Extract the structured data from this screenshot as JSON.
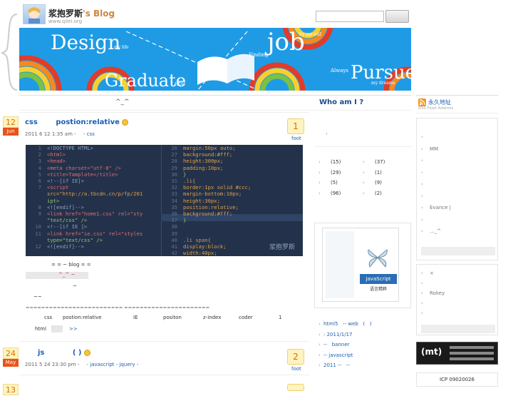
{
  "header": {
    "title": "浆抱罗斯",
    "title_suffix": "'s Blog",
    "url": "www.qilei.org",
    "search_placeholder": ""
  },
  "banner": {
    "word_design": "Design",
    "word_mylife": "my life",
    "word_finding": "Finding",
    "word_job": "job",
    "word_byself": "by my self",
    "word_graduate": "Graduate",
    "word_hdu": "HDU",
    "word_always": "Always",
    "word_pursue": "Pursue",
    "word_dreams": "my dreams"
  },
  "nav": {
    "face": "^_^"
  },
  "posts": [
    {
      "day": "12",
      "month": "Jun",
      "title_a": "css",
      "title_b": "postion:relative",
      "meta": "2011 6 12  1:35 am -",
      "meta_tag": "- css",
      "count": "1",
      "foot": "foot",
      "body": {
        "line1": "= =  ~ blog  = =",
        "line2": "^_^ ~",
        "line3": "~",
        "line4": "~~",
        "sep": "=========================    ======================",
        "keywords": [
          "css",
          "postion:relative",
          "IE",
          "positon",
          "z-index",
          "coder",
          "1"
        ],
        "html": "html",
        "more": ">>"
      }
    },
    {
      "day": "24",
      "month": "May",
      "title_a": "js",
      "title_b": "( )",
      "meta": "2011 5 24  23:30 pm -",
      "meta_tag": "- javascript - jquery -",
      "count": "2",
      "foot": "foot"
    },
    {
      "day": "13",
      "month": "",
      "title_a": "",
      "title_b": "",
      "meta": "",
      "meta_tag": "",
      "count": "",
      "foot": ""
    }
  ],
  "code": {
    "left": [
      {
        "n": "1",
        "t": "<!DOCTYPE HTML>"
      },
      {
        "n": "2",
        "t": "<html>"
      },
      {
        "n": "3",
        "t": "<head>"
      },
      {
        "n": "4",
        "t": "<meta charset=\"utf-8\" />"
      },
      {
        "n": "5",
        "t": "<title>Tamplate</title>"
      },
      {
        "n": "6",
        "t": "<!--[if IE]>"
      },
      {
        "n": "7",
        "t": "<script"
      },
      {
        "n": "",
        "t": "src=\"http://a.tbcdn.cn/p/fp/201"
      },
      {
        "n": "",
        "t": "ipt>"
      },
      {
        "n": "8",
        "t": "<![endif]-->"
      },
      {
        "n": "9",
        "t": "<link href=\"home1.css\" rel=\"sty"
      },
      {
        "n": "",
        "t": "\"text/css\" />"
      },
      {
        "n": "10",
        "t": "<!--[if IE ]>"
      },
      {
        "n": "11",
        "t": "<link href=\"ie.css\" rel=\"styles"
      },
      {
        "n": "",
        "t": "type=\"text/css\" />"
      },
      {
        "n": "12",
        "t": "<![endif]-->"
      }
    ],
    "right": [
      {
        "n": "26",
        "t": "margin:50px auto;"
      },
      {
        "n": "27",
        "t": "background:#fff;"
      },
      {
        "n": "28",
        "t": "height:300px;"
      },
      {
        "n": "29",
        "t": "padding:10px;"
      },
      {
        "n": "30",
        "t": "}"
      },
      {
        "n": "31",
        "t": ".li{"
      },
      {
        "n": "32",
        "t": "border:1px solid #ccc;"
      },
      {
        "n": "33",
        "t": "margin-bottom:10px;"
      },
      {
        "n": "34",
        "t": "height:30px;"
      },
      {
        "n": "35",
        "t": "position:relative;"
      },
      {
        "n": "36",
        "t": "background:#fff;"
      },
      {
        "n": "37",
        "t": "}"
      },
      {
        "n": "38",
        "t": ""
      },
      {
        "n": "39",
        "t": ""
      },
      {
        "n": "40",
        "t": ".li span{"
      },
      {
        "n": "41",
        "t": "display:block;"
      },
      {
        "n": "42",
        "t": "width:40px;"
      }
    ],
    "watermark": "浆抱罗斯"
  },
  "sidebar": {
    "whoami": "Who am I ?",
    "whoami_text": ".",
    "stats": [
      {
        "a": "(15)",
        "b": "(37)"
      },
      {
        "a": "(29)",
        "b": "(1)"
      },
      {
        "a": "(5)",
        "b": "(9)"
      },
      {
        "a": "(96)",
        "b": "(2)"
      }
    ],
    "book_title": "JavaScript",
    "book_sub": "语言精粹",
    "recent": [
      "html5   -- web   (   )",
      ": 2011/1/17",
      "--   banner",
      "-- javascript",
      "2011 --   --"
    ],
    "rss_title": "永久地址",
    "rss_sub": "RSS    Feed Address",
    "right_list": [
      "",
      "MM",
      "",
      "",
      "",
      "",
      "Evance |",
      "",
      "..._^"
    ],
    "right_list2": [
      "×",
      "",
      "Rokey",
      "",
      ""
    ],
    "badge": "(mt)",
    "icp": "ICP 09020026"
  },
  "colors": {
    "accent": "#1a5fb4",
    "date_bg": "#fff3c0",
    "month_bg": "#e8531c",
    "banner": "#1f9be6",
    "code_bg": "#23324a"
  }
}
